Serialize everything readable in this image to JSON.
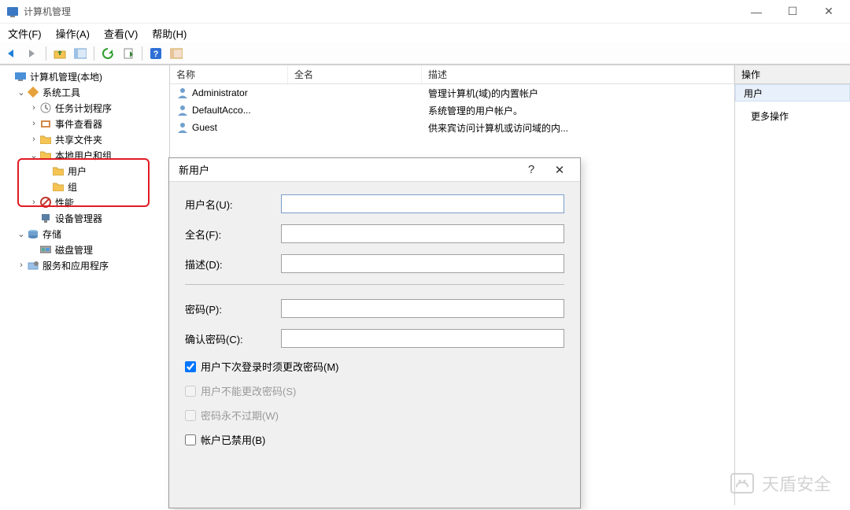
{
  "title": "计算机管理",
  "menubar": {
    "file": "文件(F)",
    "action": "操作(A)",
    "view": "查看(V)",
    "help": "帮助(H)"
  },
  "tree": {
    "root": "计算机管理(本地)",
    "system_tools": "系统工具",
    "task_scheduler": "任务计划程序",
    "event_viewer": "事件查看器",
    "shared_folders": "共享文件夹",
    "local_users_groups": "本地用户和组",
    "users": "用户",
    "groups": "组",
    "performance": "性能",
    "device_manager": "设备管理器",
    "storage": "存储",
    "disk_management": "磁盘管理",
    "services_apps": "服务和应用程序"
  },
  "list": {
    "headers": {
      "name": "名称",
      "fullname": "全名",
      "description": "描述"
    },
    "rows": [
      {
        "name": "Administrator",
        "fullname": "",
        "description": "管理计算机(域)的内置帐户"
      },
      {
        "name": "DefaultAcco...",
        "fullname": "",
        "description": "系统管理的用户帐户。"
      },
      {
        "name": "Guest",
        "fullname": "",
        "description": "供来宾访问计算机或访问域的内..."
      }
    ]
  },
  "actions": {
    "header": "操作",
    "section": "用户",
    "more": "更多操作"
  },
  "dialog": {
    "title": "新用户",
    "username_label": "用户名(U):",
    "fullname_label": "全名(F):",
    "description_label": "描述(D):",
    "password_label": "密码(P):",
    "confirm_label": "确认密码(C):",
    "chk_must_change": "用户下次登录时须更改密码(M)",
    "chk_cannot_change": "用户不能更改密码(S)",
    "chk_never_expires": "密码永不过期(W)",
    "chk_disabled": "帐户已禁用(B)"
  },
  "watermark": "天盾安全"
}
